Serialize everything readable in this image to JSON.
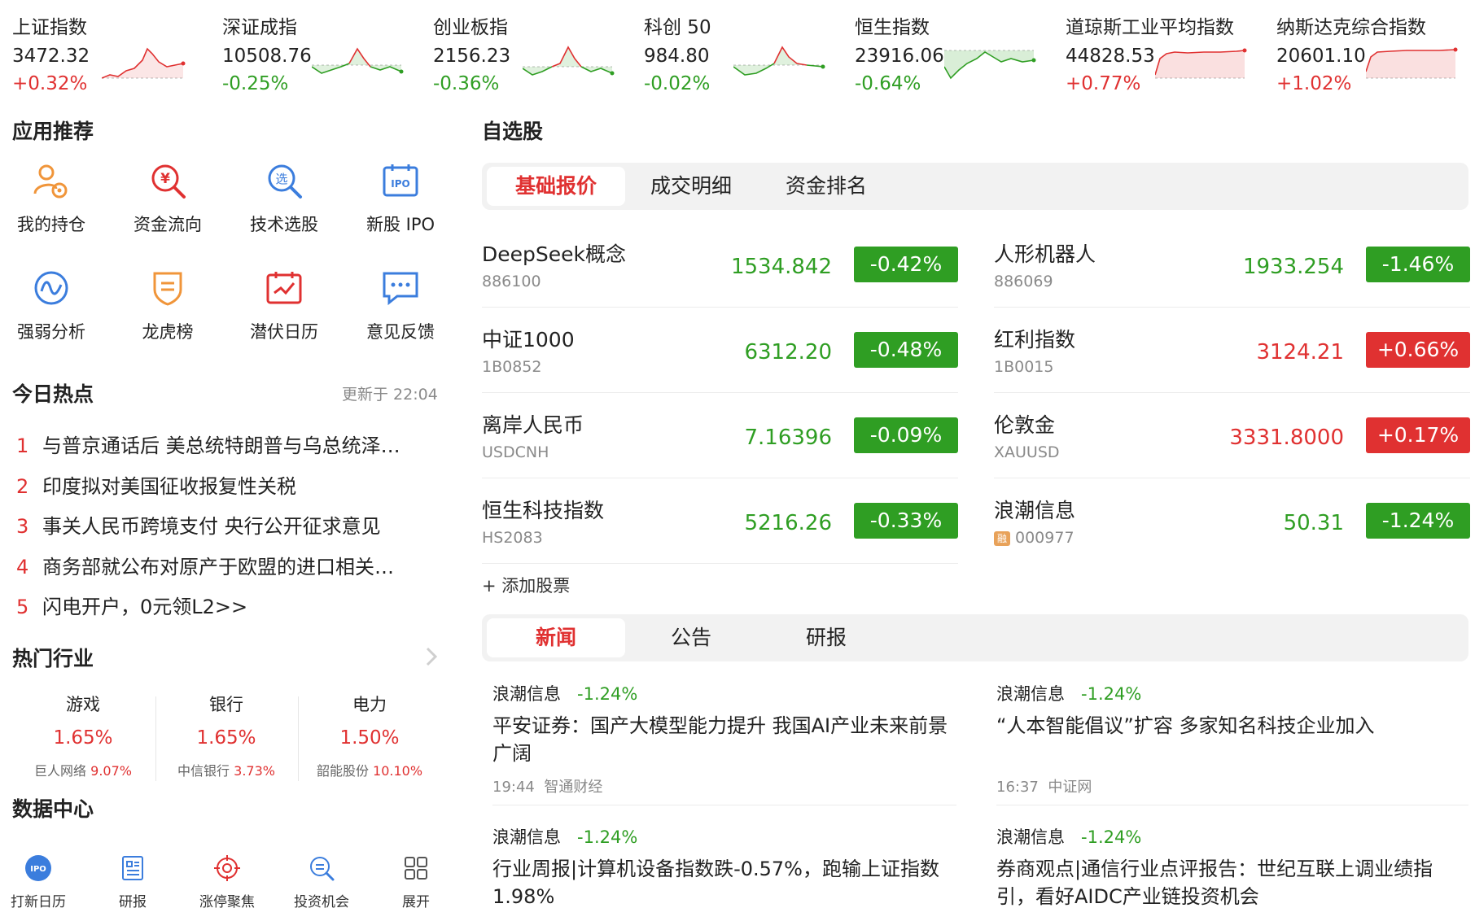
{
  "indices": [
    {
      "name": "上证指数",
      "value": "3472.32",
      "change": "+0.32%",
      "trend": "up"
    },
    {
      "name": "深证成指",
      "value": "10508.76",
      "change": "-0.25%",
      "trend": "down"
    },
    {
      "name": "创业板指",
      "value": "2156.23",
      "change": "-0.36%",
      "trend": "down"
    },
    {
      "name": "科创 50",
      "value": "984.80",
      "change": "-0.02%",
      "trend": "down"
    },
    {
      "name": "恒生指数",
      "value": "23916.06",
      "change": "-0.64%",
      "trend": "down"
    },
    {
      "name": "道琼斯工业平均指数",
      "value": "44828.53",
      "change": "+0.77%",
      "trend": "up"
    },
    {
      "name": "纳斯达克综合指数",
      "value": "20601.10",
      "change": "+1.02%",
      "trend": "up"
    }
  ],
  "apps": {
    "title": "应用推荐",
    "items": [
      {
        "label": "我的持仓",
        "icon": "holdings-icon"
      },
      {
        "label": "资金流向",
        "icon": "fund-flow-icon"
      },
      {
        "label": "技术选股",
        "icon": "stock-picker-icon"
      },
      {
        "label": "新股 IPO",
        "icon": "ipo-icon"
      },
      {
        "label": "强弱分析",
        "icon": "strength-analysis-icon"
      },
      {
        "label": "龙虎榜",
        "icon": "dragon-tiger-icon"
      },
      {
        "label": "潜伏日历",
        "icon": "calendar-icon"
      },
      {
        "label": "意见反馈",
        "icon": "feedback-icon"
      }
    ]
  },
  "hot": {
    "title": "今日热点",
    "updated": "更新于 22:04",
    "items": [
      {
        "num": "1",
        "text": "与普京通话后 美总统特朗普与乌总统泽…"
      },
      {
        "num": "2",
        "text": "印度拟对美国征收报复性关税"
      },
      {
        "num": "3",
        "text": "事关人民币跨境支付 央行公开征求意见"
      },
      {
        "num": "4",
        "text": "商务部就公布对原产于欧盟的进口相关…"
      },
      {
        "num": "5",
        "text": "闪电开户，0元领L2>>"
      }
    ]
  },
  "industries": {
    "title": "热门行业",
    "items": [
      {
        "name": "游戏",
        "pct": "1.65%",
        "stock": "巨人网络",
        "stock_pct": "9.07%"
      },
      {
        "name": "银行",
        "pct": "1.65%",
        "stock": "中信银行",
        "stock_pct": "3.73%"
      },
      {
        "name": "电力",
        "pct": "1.50%",
        "stock": "韶能股份",
        "stock_pct": "10.10%"
      }
    ]
  },
  "datacenter": {
    "title": "数据中心",
    "items": [
      {
        "label": "打新日历",
        "icon": "ipo-calendar-icon"
      },
      {
        "label": "研报",
        "icon": "research-report-icon"
      },
      {
        "label": "涨停聚焦",
        "icon": "limit-up-focus-icon"
      },
      {
        "label": "投资机会",
        "icon": "investment-opportunity-icon"
      },
      {
        "label": "展开",
        "icon": "grid-expand-icon"
      }
    ]
  },
  "watchlist": {
    "title": "自选股",
    "tabs": [
      "基础报价",
      "成交明细",
      "资金排名"
    ],
    "active_tab": 0,
    "stocks": [
      {
        "name": "DeepSeek概念",
        "code": "886100",
        "price": "1534.842",
        "change": "-0.42%",
        "dir": "down"
      },
      {
        "name": "人形机器人",
        "code": "886069",
        "price": "1933.254",
        "change": "-1.46%",
        "dir": "down"
      },
      {
        "name": "中证1000",
        "code": "1B0852",
        "price": "6312.20",
        "change": "-0.48%",
        "dir": "down"
      },
      {
        "name": "红利指数",
        "code": "1B0015",
        "price": "3124.21",
        "change": "+0.66%",
        "dir": "up"
      },
      {
        "name": "离岸人民币",
        "code": "USDCNH",
        "price": "7.16396",
        "change": "-0.09%",
        "dir": "down"
      },
      {
        "name": "伦敦金",
        "code": "XAUUSD",
        "price": "3331.8000",
        "change": "+0.17%",
        "dir": "up"
      },
      {
        "name": "恒生科技指数",
        "code": "HS2083",
        "price": "5216.26",
        "change": "-0.33%",
        "dir": "down"
      },
      {
        "name": "浪潮信息",
        "code": "000977",
        "tag": "融",
        "price": "50.31",
        "change": "-1.24%",
        "dir": "down"
      }
    ],
    "add_label": "+ 添加股票"
  },
  "news": {
    "tabs": [
      "新闻",
      "公告",
      "研报"
    ],
    "active_tab": 0,
    "items": [
      {
        "stock": "浪潮信息",
        "pct": "-1.24%",
        "title": "平安证券：国产大模型能力提升 我国AI产业未来前景广阔",
        "time": "19:44",
        "source": "智通财经"
      },
      {
        "stock": "浪潮信息",
        "pct": "-1.24%",
        "title": "“人本智能倡议”扩容 多家知名科技企业加入",
        "time": "16:37",
        "source": "中证网"
      },
      {
        "stock": "浪潮信息",
        "pct": "-1.24%",
        "title": "行业周报|计算机设备指数跌-0.57%，跑输上证指数1.98%",
        "time": "",
        "source": ""
      },
      {
        "stock": "浪潮信息",
        "pct": "-1.24%",
        "title": "券商观点|通信行业点评报告：世纪互联上调业绩指引，看好AIDC产业链投资机会",
        "time": "",
        "source": ""
      }
    ]
  },
  "colors": {
    "up": "#e03131",
    "down": "#2f9e23",
    "tab_bg": "#f2f2f2"
  }
}
